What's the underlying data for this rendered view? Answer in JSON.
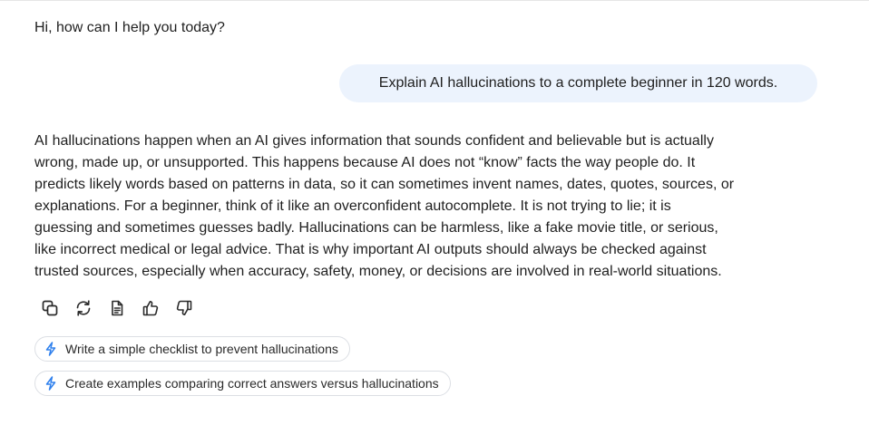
{
  "conversation": {
    "greeting": "Hi, how can I help you today?",
    "user_message": "Explain AI hallucinations to a complete beginner in 120 words.",
    "assistant_response_lines": [
      "AI hallucinations happen when an AI gives information that sounds confident and believable but is actually",
      "wrong, made up, or unsupported. This happens because AI does not “know” facts the way people do. It",
      "predicts likely words based on patterns in data, so it can sometimes invent names, dates, quotes, sources, or",
      "explanations. For a beginner, think of it like an overconfident autocomplete. It is not trying to lie; it is",
      "guessing and sometimes guesses badly. Hallucinations can be harmless, like a fake movie title, or serious,",
      "like incorrect medical or legal advice. That is why important AI outputs should always be checked against",
      "trusted sources, especially when accuracy, safety, money, or decisions are involved in real-world situations."
    ]
  },
  "response_actions": [
    {
      "icon": "copy-icon"
    },
    {
      "icon": "regenerate-icon"
    },
    {
      "icon": "document-icon"
    },
    {
      "icon": "thumbs-up-icon"
    },
    {
      "icon": "thumbs-down-icon"
    }
  ],
  "suggestions": [
    {
      "icon": "lightning-bolt-icon",
      "label": "Write a simple checklist to prevent hallucinations"
    },
    {
      "icon": "lightning-bolt-icon",
      "label": "Create examples comparing correct answers versus hallucinations"
    }
  ],
  "colors": {
    "user_bubble_bg": "#ecf3fd",
    "text": "#1f1f1f",
    "icon_stroke": "#2b2b2b",
    "suggestion_bolt": "#2f80ed",
    "chip_border": "#dcdfe4"
  }
}
